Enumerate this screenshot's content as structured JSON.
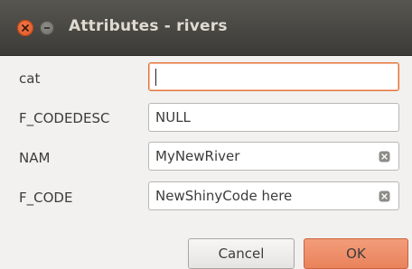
{
  "window": {
    "title": "Attributes - rivers"
  },
  "fields": [
    {
      "label": "cat",
      "value": ""
    },
    {
      "label": "F_CODEDESC",
      "value": "NULL"
    },
    {
      "label": "NAM",
      "value": "MyNewRiver"
    },
    {
      "label": "F_CODE",
      "value": "NewShinyCode here"
    }
  ],
  "buttons": {
    "cancel_label": "Cancel",
    "ok_label": "OK"
  },
  "colors": {
    "titlebar": "#3c3b37",
    "close_button": "#e05c2a",
    "focus_border": "#e3743d",
    "ok_button": "#ec8b65"
  },
  "icons": {
    "close": "close-icon",
    "minimize": "minimize-icon",
    "clear": "clear-field-icon"
  }
}
